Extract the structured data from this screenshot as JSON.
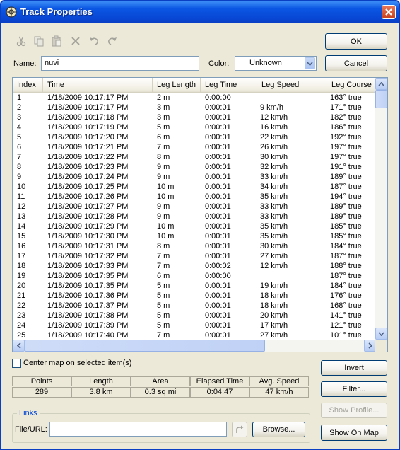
{
  "window": {
    "title": "Track Properties"
  },
  "toolbar": {
    "icons": [
      "cut-icon",
      "copy-icon",
      "paste-icon",
      "delete-icon",
      "undo-icon",
      "redo-icon"
    ]
  },
  "form": {
    "name_label": "Name:",
    "name_value": "nuvi",
    "color_label": "Color:",
    "color_value": "Unknown"
  },
  "buttons": {
    "ok": "OK",
    "cancel": "Cancel",
    "invert": "Invert",
    "filter": "Filter...",
    "show_profile": "Show Profile...",
    "show_on_map": "Show On Map",
    "browse": "Browse..."
  },
  "table": {
    "columns": [
      "Index",
      "Time",
      "Leg Length",
      "Leg Time",
      "Leg Speed",
      "Leg Course"
    ],
    "rows": [
      [
        "1",
        "1/18/2009 10:17:17 PM",
        "2 m",
        "0:00:00",
        "",
        "163° true"
      ],
      [
        "2",
        "1/18/2009 10:17:17 PM",
        "3 m",
        "0:00:01",
        "9 km/h",
        "171° true"
      ],
      [
        "3",
        "1/18/2009 10:17:18 PM",
        "3 m",
        "0:00:01",
        "12 km/h",
        "182° true"
      ],
      [
        "4",
        "1/18/2009 10:17:19 PM",
        "5 m",
        "0:00:01",
        "16 km/h",
        "186° true"
      ],
      [
        "5",
        "1/18/2009 10:17:20 PM",
        "6 m",
        "0:00:01",
        "22 km/h",
        "192° true"
      ],
      [
        "6",
        "1/18/2009 10:17:21 PM",
        "7 m",
        "0:00:01",
        "26 km/h",
        "197° true"
      ],
      [
        "7",
        "1/18/2009 10:17:22 PM",
        "8 m",
        "0:00:01",
        "30 km/h",
        "197° true"
      ],
      [
        "8",
        "1/18/2009 10:17:23 PM",
        "9 m",
        "0:00:01",
        "32 km/h",
        "191° true"
      ],
      [
        "9",
        "1/18/2009 10:17:24 PM",
        "9 m",
        "0:00:01",
        "33 km/h",
        "189° true"
      ],
      [
        "10",
        "1/18/2009 10:17:25 PM",
        "10 m",
        "0:00:01",
        "34 km/h",
        "187° true"
      ],
      [
        "11",
        "1/18/2009 10:17:26 PM",
        "10 m",
        "0:00:01",
        "35 km/h",
        "194° true"
      ],
      [
        "12",
        "1/18/2009 10:17:27 PM",
        "9 m",
        "0:00:01",
        "33 km/h",
        "189° true"
      ],
      [
        "13",
        "1/18/2009 10:17:28 PM",
        "9 m",
        "0:00:01",
        "33 km/h",
        "189° true"
      ],
      [
        "14",
        "1/18/2009 10:17:29 PM",
        "10 m",
        "0:00:01",
        "35 km/h",
        "185° true"
      ],
      [
        "15",
        "1/18/2009 10:17:30 PM",
        "10 m",
        "0:00:01",
        "35 km/h",
        "185° true"
      ],
      [
        "16",
        "1/18/2009 10:17:31 PM",
        "8 m",
        "0:00:01",
        "30 km/h",
        "184° true"
      ],
      [
        "17",
        "1/18/2009 10:17:32 PM",
        "7 m",
        "0:00:01",
        "27 km/h",
        "187° true"
      ],
      [
        "18",
        "1/18/2009 10:17:33 PM",
        "7 m",
        "0:00:02",
        "12 km/h",
        "188° true"
      ],
      [
        "19",
        "1/18/2009 10:17:35 PM",
        "6 m",
        "0:00:00",
        "",
        "187° true"
      ],
      [
        "20",
        "1/18/2009 10:17:35 PM",
        "5 m",
        "0:00:01",
        "19 km/h",
        "184° true"
      ],
      [
        "21",
        "1/18/2009 10:17:36 PM",
        "5 m",
        "0:00:01",
        "18 km/h",
        "176° true"
      ],
      [
        "22",
        "1/18/2009 10:17:37 PM",
        "5 m",
        "0:00:01",
        "18 km/h",
        "168° true"
      ],
      [
        "23",
        "1/18/2009 10:17:38 PM",
        "5 m",
        "0:00:01",
        "20 km/h",
        "141° true"
      ],
      [
        "24",
        "1/18/2009 10:17:39 PM",
        "5 m",
        "0:00:01",
        "17 km/h",
        "121° true"
      ],
      [
        "25",
        "1/18/2009 10:17:40 PM",
        "7 m",
        "0:00:01",
        "27 km/h",
        "101° true"
      ]
    ]
  },
  "center_map": {
    "label": "Center map on selected item(s)",
    "checked": false
  },
  "stats": [
    {
      "label": "Points",
      "value": "289"
    },
    {
      "label": "Length",
      "value": "3.8 km"
    },
    {
      "label": "Area",
      "value": "0.3 sq mi"
    },
    {
      "label": "Elapsed Time",
      "value": "0:04:47"
    },
    {
      "label": "Avg. Speed",
      "value": "47 km/h"
    }
  ],
  "links": {
    "legend": "Links",
    "file_url_label": "File/URL:",
    "file_url_value": ""
  },
  "colors": {
    "title_bar": "#0a56e3",
    "dialog_bg": "#ece9d8",
    "group_legend": "#0046d5"
  }
}
